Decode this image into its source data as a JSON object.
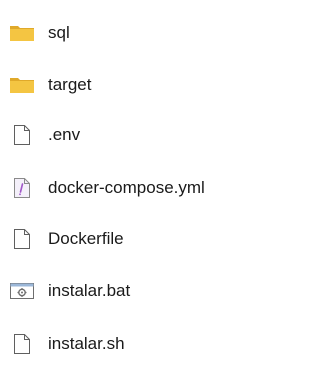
{
  "files": [
    {
      "name": "sql",
      "icon": "folder-icon"
    },
    {
      "name": "target",
      "icon": "folder-icon"
    },
    {
      "name": ".env",
      "icon": "file-icon"
    },
    {
      "name": "docker-compose.yml",
      "icon": "yaml-file-icon"
    },
    {
      "name": "Dockerfile",
      "icon": "file-icon"
    },
    {
      "name": "instalar.bat",
      "icon": "batch-file-icon"
    },
    {
      "name": "instalar.sh",
      "icon": "file-icon"
    }
  ],
  "colors": {
    "folder": "#f4c542",
    "folder_dark": "#e0a92a",
    "file_outline": "#5f5f5f",
    "yaml_accent": "#a056c8"
  }
}
